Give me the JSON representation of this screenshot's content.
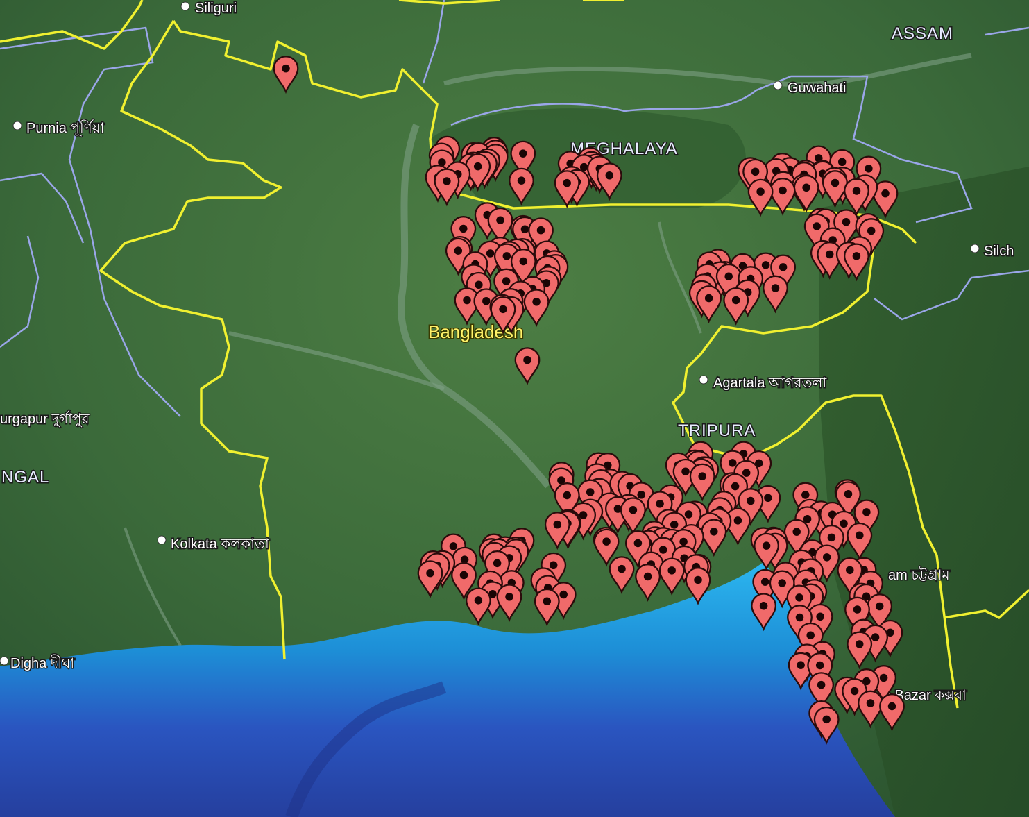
{
  "map": {
    "regions": [
      "ASSAM",
      "MEGHALAYA",
      "TRIPURA",
      "NGAL"
    ],
    "country": "Bangladesh",
    "cities": [
      "Siliguri",
      "Guwahati",
      "Purnia পূর্ণিয়া",
      "Silch",
      "Agartala আগরতলা",
      "urgapur দুর্গাপুর",
      "Kolkata কলকাতা",
      "am চট্টগ্রাম",
      "Digha দীঘা",
      "'s Bazar কক্সবা"
    ],
    "colors": {
      "land": "#3c6b3a",
      "sea_shallow": "#1fa0e0",
      "sea_deep": "#2a4fb8",
      "intl_border": "#f0f030",
      "state_border": "#9aa6e8",
      "marker": "#f06060"
    },
    "marker_icon": "map-pin-icon"
  }
}
